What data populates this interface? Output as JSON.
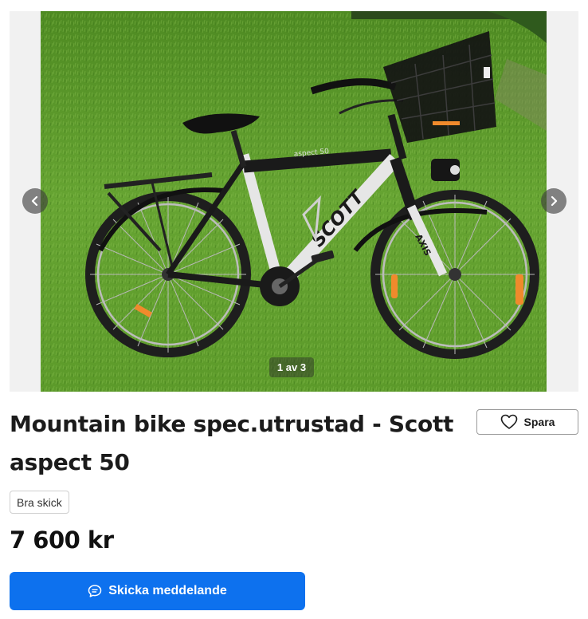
{
  "listing": {
    "title": "Mountain bike spec.utrustad - Scott aspect 50",
    "condition_badge": "Bra skick",
    "price": "7 600 kr"
  },
  "gallery": {
    "counter": "1 av 3",
    "prev_icon": "chevron-left-icon",
    "next_icon": "chevron-right-icon",
    "bike_frame_text": "SCOTT",
    "bike_fork_text": "AXIS",
    "bike_top_tube_text": "aspect 50",
    "colors": {
      "grass": "#5e9a2c",
      "frame": "#1a1a1a",
      "frame_white": "#e8e8e8"
    }
  },
  "actions": {
    "save_label": "Spara",
    "save_icon": "heart-outline-icon",
    "message_label": "Skicka meddelande",
    "message_icon": "chat-bubble-icon",
    "accent": "#0d71ee"
  }
}
